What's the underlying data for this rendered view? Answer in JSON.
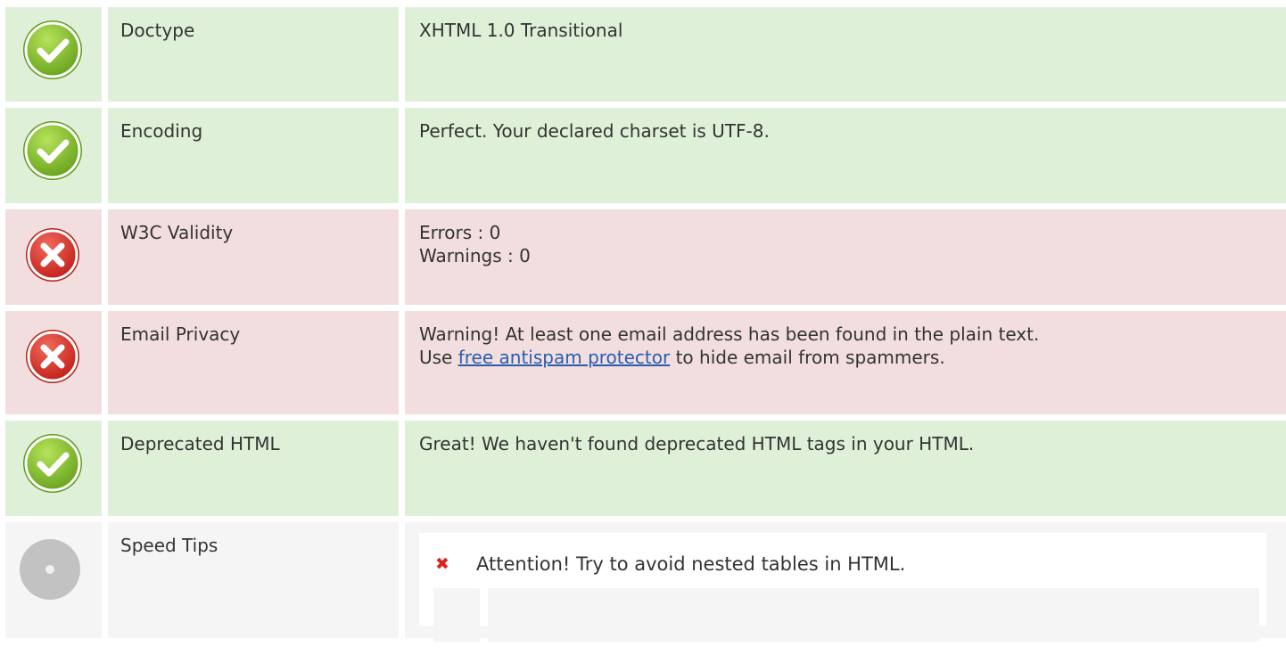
{
  "rows": [
    {
      "status": "ok",
      "icon": "check-circle-icon",
      "label": "Doctype",
      "value_lines": [
        "XHTML 1.0 Transitional"
      ]
    },
    {
      "status": "ok",
      "icon": "check-circle-icon",
      "label": "Encoding",
      "value_lines": [
        "Perfect. Your declared charset is UTF-8."
      ]
    },
    {
      "status": "bad",
      "icon": "x-circle-icon",
      "label": "W3C Validity",
      "value_lines": [
        "Errors : 0",
        "Warnings : 0"
      ]
    },
    {
      "status": "bad",
      "icon": "x-circle-icon",
      "label": "Email Privacy",
      "value_line1": "Warning! At least one email address has been found in the plain text.",
      "value_line2_prefix": "Use ",
      "value_line2_link": "free antispam protector",
      "value_line2_suffix": " to hide email from spammers."
    },
    {
      "status": "ok",
      "icon": "check-circle-icon",
      "label": "Deprecated HTML",
      "value_lines": [
        "Great! We haven't found deprecated HTML tags in your HTML."
      ]
    },
    {
      "status": "neutral",
      "icon": "neutral-circle-icon",
      "label": "Speed Tips",
      "tip_icon": "x-mark-icon",
      "tip_mark": "✖",
      "tip_text": "Attention! Try to avoid nested tables in HTML."
    }
  ],
  "colors": {
    "ok_bg": "#dff0d8",
    "bad_bg": "#f2dede",
    "neutral_bg": "#f5f5f5",
    "ok_icon": "#8cc63f",
    "bad_icon": "#d9302c",
    "neutral_icon": "#c2c2c2",
    "link": "#2a5db0",
    "tip_x": "#e02020"
  }
}
